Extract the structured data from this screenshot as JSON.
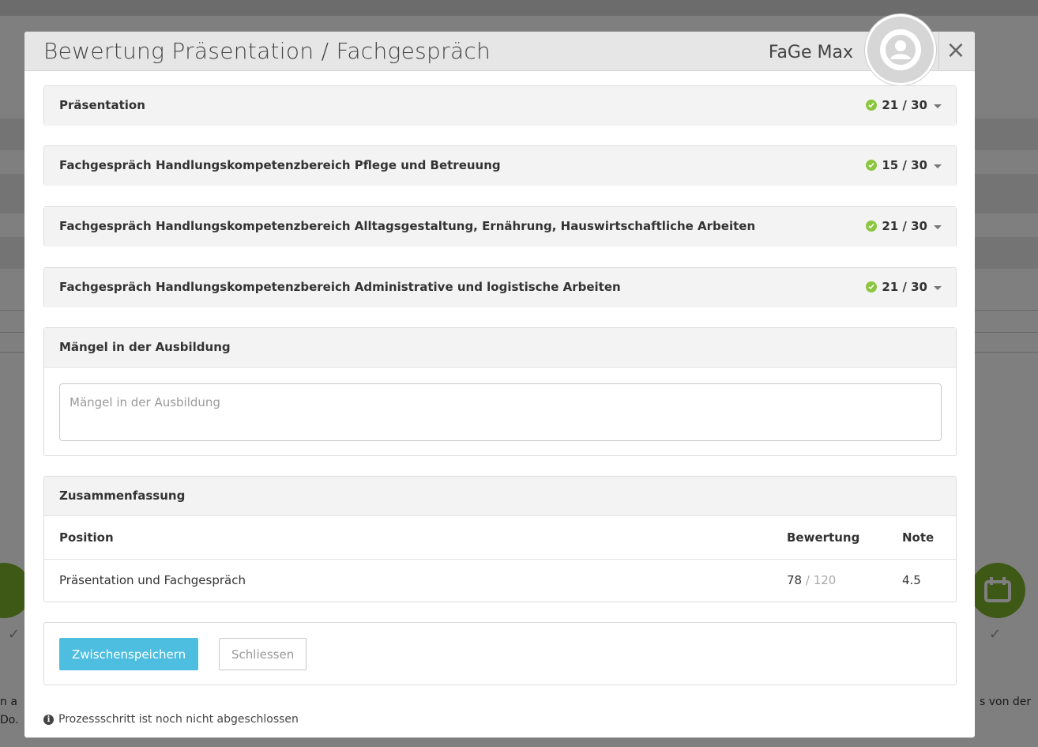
{
  "background": {
    "left_text_1": "n a",
    "left_text_2": "Do.",
    "right_text": "s von der",
    "check_mark": "✓"
  },
  "modal": {
    "title": "Bewertung Präsentation / Fachgespräch",
    "user_name": "FaGe Max",
    "close_label": "×"
  },
  "sections": [
    {
      "title": "Präsentation",
      "score": "21 / 30"
    },
    {
      "title": "Fachgespräch Handlungskompetenzbereich Pflege und Betreuung",
      "score": "15 / 30"
    },
    {
      "title": "Fachgespräch Handlungskompetenzbereich Alltagsgestaltung, Ernährung, Hauswirtschaftliche Arbeiten",
      "score": "21 / 30"
    },
    {
      "title": "Fachgespräch Handlungskompetenzbereich Administrative und logistische Arbeiten",
      "score": "21 / 30"
    }
  ],
  "maengel": {
    "title": "Mängel in der Ausbildung",
    "placeholder": "Mängel in der Ausbildung",
    "value": ""
  },
  "summary": {
    "title": "Zusammenfassung",
    "columns": {
      "position": "Position",
      "bewertung": "Bewertung",
      "note": "Note"
    },
    "rows": [
      {
        "position": "Präsentation und Fachgespräch",
        "score": "78",
        "separator": " / ",
        "max": "120",
        "note": "4.5"
      }
    ]
  },
  "actions": {
    "save_label": "Zwischenspeichern",
    "close_label": "Schliessen"
  },
  "status_text": "Prozessschritt ist noch nicht abgeschlossen",
  "colors": {
    "accent": "#4dbde0",
    "success": "#8cc63f",
    "background_green": "#7db22a"
  }
}
